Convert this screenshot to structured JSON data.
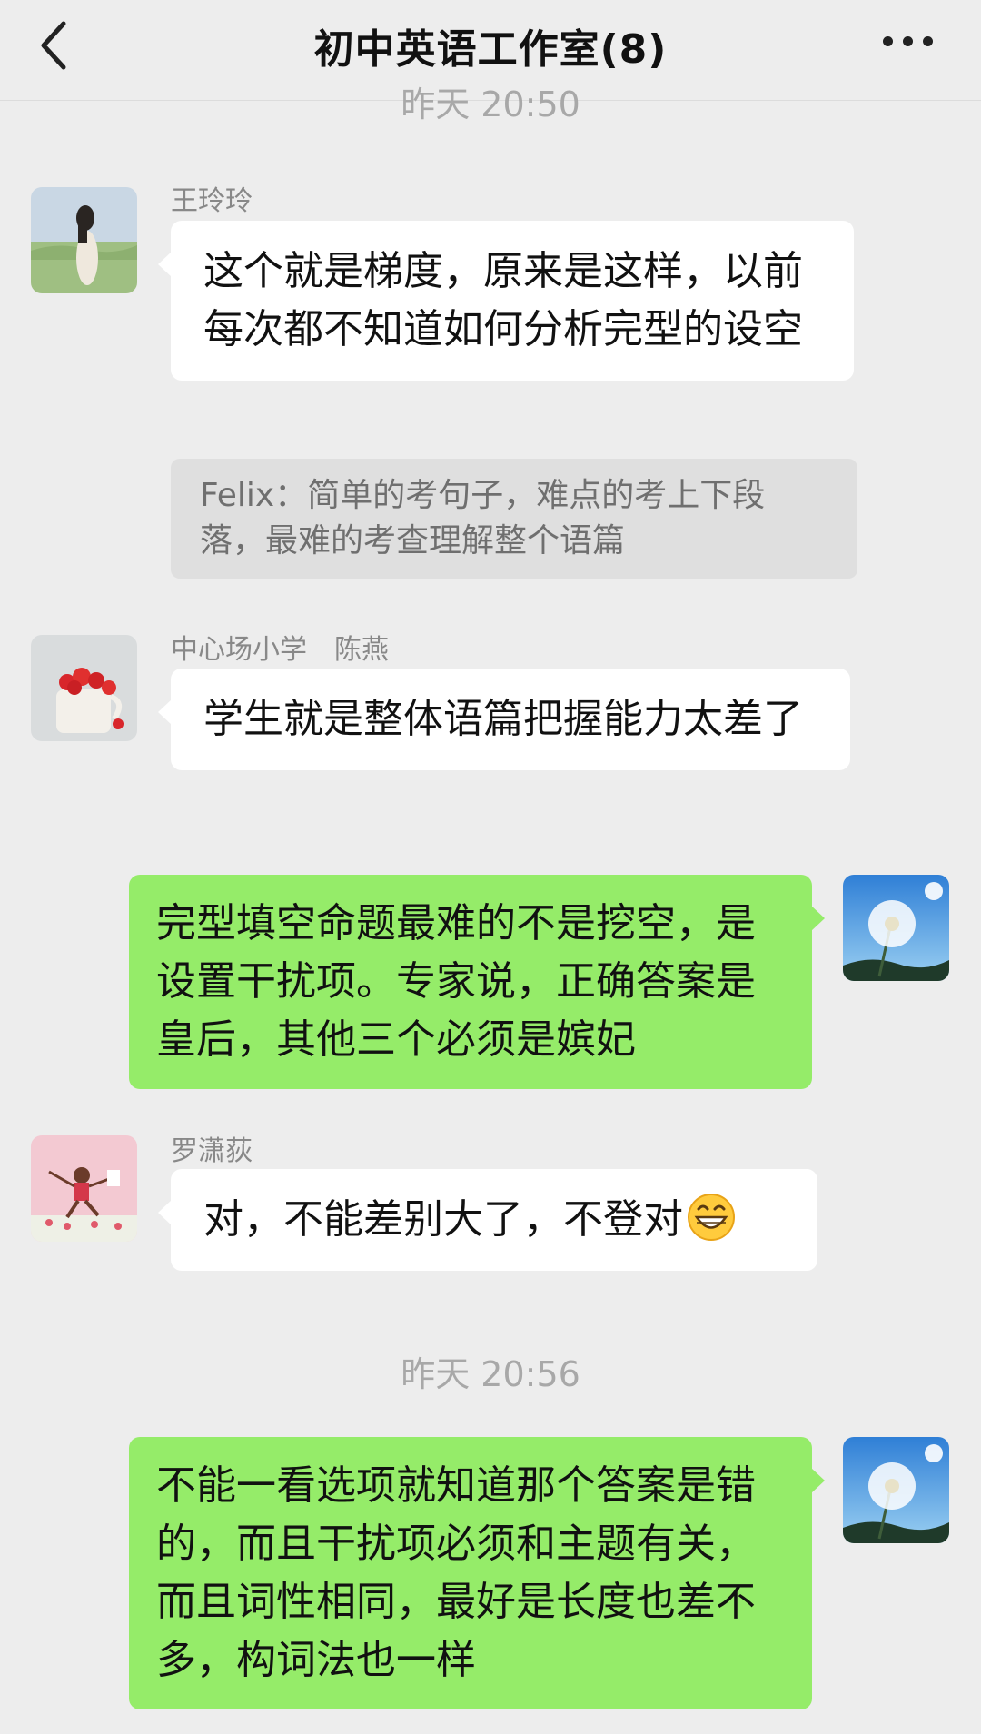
{
  "header": {
    "title": "初中英语工作室(8)"
  },
  "timestamps": [
    "昨天 20:50",
    "昨天 20:56"
  ],
  "messages": [
    {
      "sender": "王玲玲",
      "text": "这个就是梯度，原来是这样，以前每次都不知道如何分析完型的设空",
      "quote": "Felix：简单的考句子，难点的考上下段落，最难的考查理解整个语篇"
    },
    {
      "sender": "中心场小学　陈燕",
      "text": "学生就是整体语篇把握能力太差了"
    },
    {
      "text": "完型填空命题最难的不是挖空，是设置干扰项。专家说，正确答案是皇后，其他三个必须是嫔妃"
    },
    {
      "sender": "罗潇荻",
      "text": "对，不能差别大了，不登对",
      "emoji": "grinning-face-icon"
    },
    {
      "text": "不能一看选项就知道那个答案是错的，而且干扰项必须和主题有关，而且词性相同，最好是长度也差不多，构词法也一样"
    }
  ],
  "colors": {
    "background": "#ededed",
    "outgoing_bubble": "#95ec69",
    "incoming_bubble": "#ffffff",
    "quote_bg": "#dfdfdf"
  }
}
